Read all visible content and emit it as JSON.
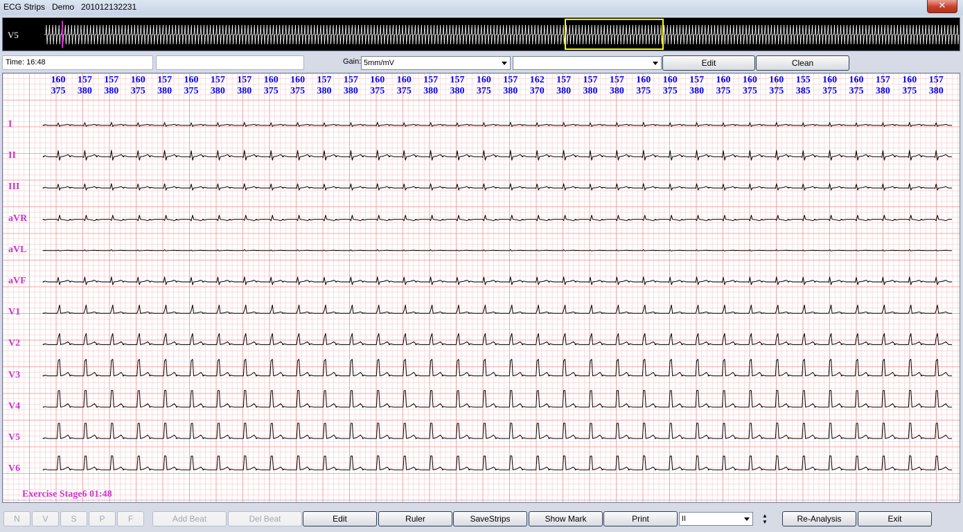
{
  "window": {
    "title": "ECG Strips   Demo   201012132231",
    "close_glyph": "✕"
  },
  "overview": {
    "lead": "V5"
  },
  "info": {
    "time": "Time: 16:48",
    "gain_label": "Gain:",
    "gain_value": "5mm/mV",
    "second_combo_value": "",
    "edit_label": "Edit",
    "clean_label": "Clean"
  },
  "heart_rates": [
    160,
    157,
    157,
    160,
    157,
    160,
    157,
    157,
    160,
    160,
    157,
    157,
    160,
    160,
    157,
    157,
    160,
    157,
    162,
    157,
    157,
    157,
    160,
    160,
    157,
    160,
    160,
    160,
    155,
    160,
    160,
    157,
    160,
    157
  ],
  "rr_intervals": [
    375,
    380,
    380,
    375,
    380,
    375,
    380,
    380,
    375,
    375,
    380,
    380,
    375,
    375,
    380,
    380,
    375,
    380,
    370,
    380,
    380,
    380,
    375,
    375,
    380,
    375,
    375,
    375,
    385,
    375,
    375,
    380,
    375,
    380
  ],
  "leads": [
    "I",
    "II",
    "III",
    "aVR",
    "aVL",
    "aVF",
    "V1",
    "V2",
    "V3",
    "V4",
    "V5",
    "V6"
  ],
  "stage_text": "Exercise Stage6 01:48",
  "toolbar": {
    "beat_buttons": [
      "N",
      "V",
      "S",
      "P",
      "F"
    ],
    "add_beat": "Add Beat",
    "del_beat": "Del Beat",
    "edit": "Edit",
    "ruler": "Ruler",
    "save_strips": "SaveStrips",
    "show_mark": "Show Mark",
    "print": "Print",
    "lead_select": "II",
    "spin_up": "▲",
    "spin_down": "▼",
    "re_analysis": "Re-Analysis",
    "exit": "Exit"
  },
  "colors": {
    "grid_minor": "#f6c9c9",
    "grid_major": "#ee8f8f",
    "trace": "#000000",
    "heart_rate_text": "#0000ff",
    "lead_label_text": "#cc33cc",
    "overview_trace": "#ffffff",
    "overview_marker": "#cc33cc",
    "overview_window": "#ffff00"
  }
}
